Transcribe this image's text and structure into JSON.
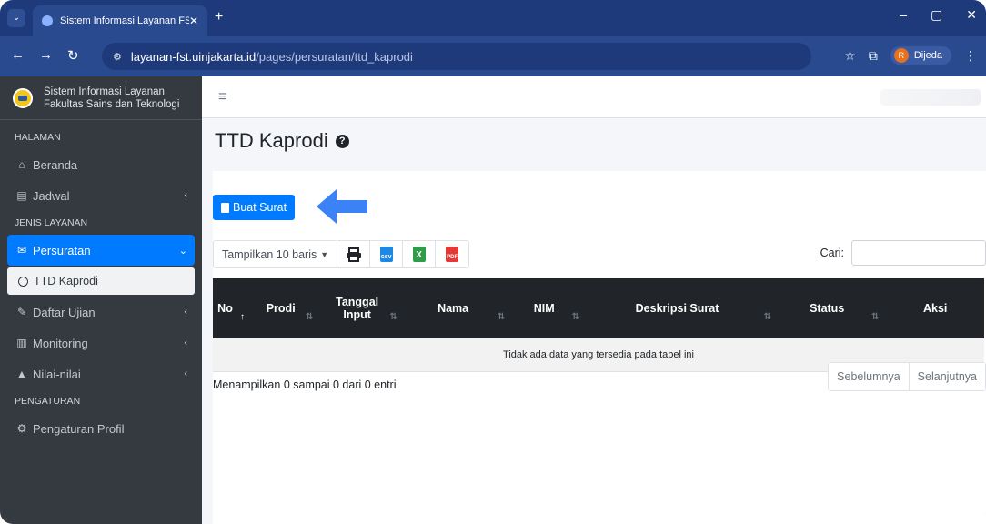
{
  "browser": {
    "tab_title": "Sistem Informasi Layanan FST",
    "url_host": "layanan-fst.uinjakarta.id",
    "url_path": "/pages/persuratan/ttd_kaprodi",
    "profile_name": "Dijeda",
    "profile_initial": "R"
  },
  "sidebar": {
    "brand_line1": "Sistem Informasi Layanan",
    "brand_line2": "Fakultas Sains dan Teknologi",
    "header_halaman": "HALAMAN",
    "beranda": "Beranda",
    "jadwal": "Jadwal",
    "header_jenis": "JENIS LAYANAN",
    "persuratan": "Persuratan",
    "ttd_kaprodi": "TTD Kaprodi",
    "daftar_ujian": "Daftar Ujian",
    "monitoring": "Monitoring",
    "nilai": "Nilai-nilai",
    "header_pengaturan": "PENGATURAN",
    "pengaturan_profil": "Pengaturan Profil"
  },
  "page": {
    "title": "TTD Kaprodi",
    "create_button": "Buat Surat",
    "length_label": "Tampilkan 10 baris",
    "search_label": "Cari:",
    "empty_message": "Tidak ada data yang tersedia pada tabel ini",
    "info": "Menampilkan 0 sampai 0 dari 0 entri",
    "prev": "Sebelumnya",
    "next": "Selanjutnya"
  },
  "table": {
    "col_no": "No",
    "col_prodi": "Prodi",
    "col_tanggal1": "Tanggal",
    "col_tanggal2": "Input",
    "col_nama": "Nama",
    "col_nim": "NIM",
    "col_deskripsi": "Deskripsi Surat",
    "col_status": "Status",
    "col_aksi": "Aksi"
  },
  "icons": {
    "csv_label": "csv",
    "xls_label": "X",
    "pdf_label": "PDF"
  },
  "colors": {
    "primary": "#007bff",
    "sidebar_bg": "#343a40",
    "table_head": "#212529",
    "browser_chrome": "#2a4a8f"
  }
}
